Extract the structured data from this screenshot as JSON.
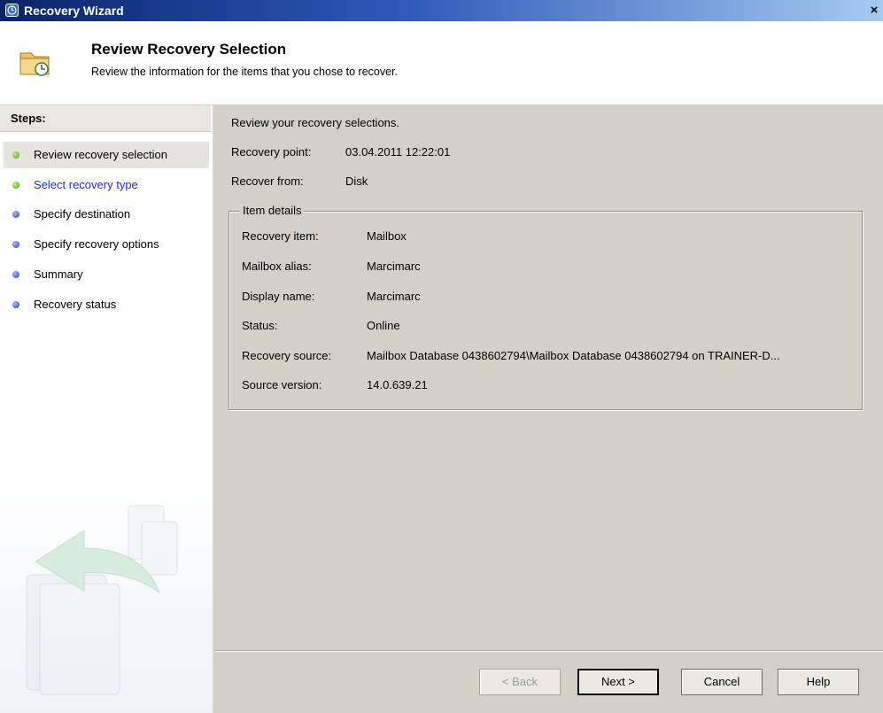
{
  "window": {
    "title": "Recovery Wizard",
    "close_glyph": "×"
  },
  "header": {
    "title": "Review Recovery Selection",
    "subtitle": "Review the information for the items that you chose to recover."
  },
  "steps": {
    "title": "Steps:",
    "items": [
      {
        "label": "Review recovery selection",
        "state": "current",
        "bullet": "green"
      },
      {
        "label": "Select recovery type",
        "state": "link",
        "bullet": "green"
      },
      {
        "label": "Specify destination",
        "state": "normal",
        "bullet": "blue"
      },
      {
        "label": "Specify recovery options",
        "state": "normal",
        "bullet": "blue"
      },
      {
        "label": "Summary",
        "state": "normal",
        "bullet": "blue"
      },
      {
        "label": "Recovery status",
        "state": "normal",
        "bullet": "blue"
      }
    ]
  },
  "main": {
    "intro": "Review your recovery selections.",
    "recovery_point": {
      "label": "Recovery point:",
      "value": "03.04.2011 12:22:01"
    },
    "recover_from": {
      "label": "Recover from:",
      "value": "Disk"
    },
    "item_details": {
      "legend": "Item details",
      "rows": [
        {
          "label": "Recovery item:",
          "value": "Mailbox"
        },
        {
          "label": "Mailbox alias:",
          "value": "Marcimarc"
        },
        {
          "label": "Display name:",
          "value": "Marcimarc"
        },
        {
          "label": "Status:",
          "value": "Online"
        },
        {
          "label": "Recovery source:",
          "value": "Mailbox Database 0438602794\\Mailbox Database 0438602794 on TRAINER-D..."
        },
        {
          "label": "Source version:",
          "value": "14.0.639.21"
        }
      ]
    }
  },
  "buttons": {
    "back": "< Back",
    "next": "Next >",
    "cancel": "Cancel",
    "help": "Help"
  },
  "colors": {
    "panel": "#d4d0c8",
    "link": "#1f2ce0",
    "titlebar_start": "#0a246a",
    "titlebar_end": "#a6caf0"
  }
}
